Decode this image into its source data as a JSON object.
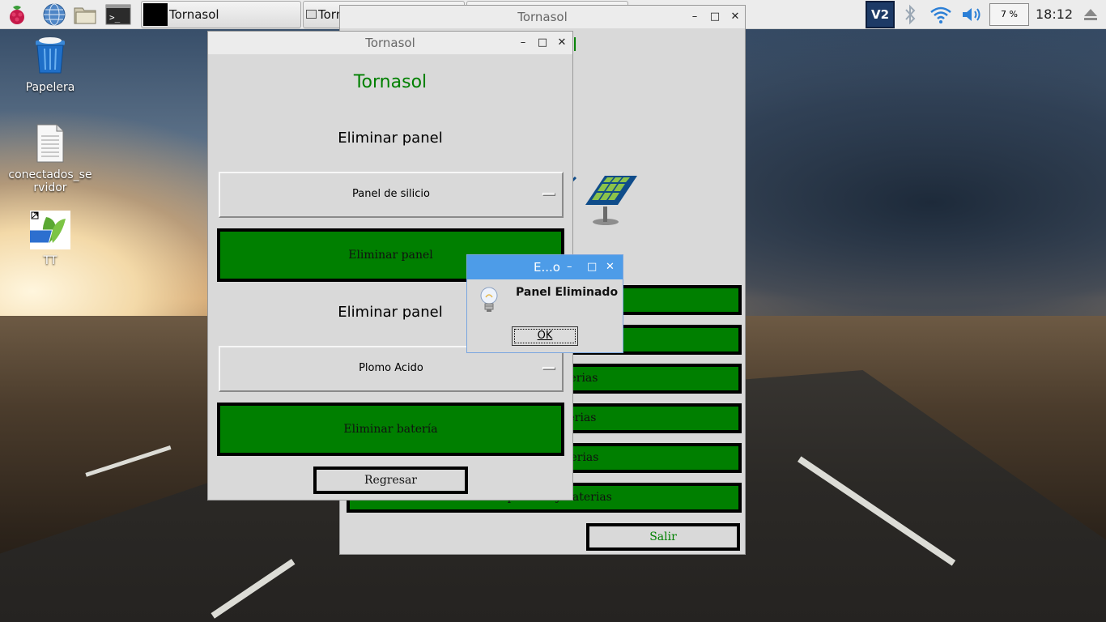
{
  "taskbar": {
    "tasks": [
      {
        "label": "Tornasol"
      },
      {
        "label": "Torn"
      },
      {
        "label": ""
      }
    ],
    "cpu_label": "7 %",
    "clock": "18:12",
    "vnc_label": "V2"
  },
  "desktop": {
    "icons": [
      {
        "label": "Papelera"
      },
      {
        "label": "conectados_se"
      },
      {
        "label": "rvidor"
      },
      {
        "label": "TT"
      }
    ]
  },
  "back_window": {
    "title": "Tornasol",
    "partial_title": "l",
    "buttons": [
      "baterias",
      "baterias",
      "baterias",
      "Usar paneles y baterias"
    ],
    "exit_label": "Salir"
  },
  "front_window": {
    "title": "Tornasol",
    "app_title": "Tornasol",
    "section_panel": "Eliminar panel",
    "panel_select": "Panel de silicio",
    "delete_panel_button": "Eliminar panel",
    "section_battery": "Eliminar panel",
    "battery_select": "Plomo Acido",
    "delete_battery_button": "Eliminar batería",
    "back_button": "Regresar"
  },
  "dialog": {
    "title": "E...o",
    "message": "Panel Eliminado",
    "ok_label": "OK"
  },
  "colors": {
    "accent_green": "#007f00",
    "title_green": "#008000",
    "dialog_blue": "#4d9ce8"
  }
}
